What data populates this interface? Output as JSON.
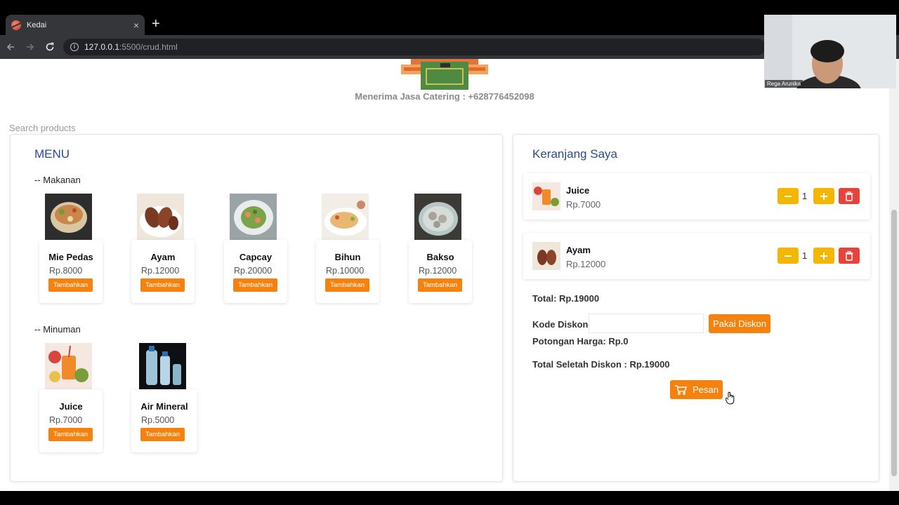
{
  "browser": {
    "tab_title": "Kedai",
    "tab_close": "×",
    "new_tab": "+",
    "url_host": "127.0.0.1",
    "url_path": ":5500/crud.html"
  },
  "header": {
    "catering_text": "Menerima Jasa Catering : +628776452098"
  },
  "search": {
    "placeholder": "Search products"
  },
  "menu": {
    "title": "MENU",
    "sections": [
      {
        "label": "-- Makanan",
        "items": [
          {
            "name": "Mie Pedas",
            "price": "Rp.8000",
            "button": "Tambahkan"
          },
          {
            "name": "Ayam",
            "price": "Rp.12000",
            "button": "Tambahkan"
          },
          {
            "name": "Capcay",
            "price": "Rp.20000",
            "button": "Tambahkan"
          },
          {
            "name": "Bihun",
            "price": "Rp.10000",
            "button": "Tambahkan"
          },
          {
            "name": "Bakso",
            "price": "Rp.12000",
            "button": "Tambahkan"
          }
        ]
      },
      {
        "label": "-- Minuman",
        "items": [
          {
            "name": "Juice",
            "price": "Rp.7000",
            "button": "Tambahkan"
          },
          {
            "name": "Air Mineral",
            "price": "Rp.5000",
            "button": "Tambahkan"
          }
        ]
      }
    ]
  },
  "cart": {
    "title": "Keranjang Saya",
    "items": [
      {
        "name": "Juice",
        "price": "Rp.7000",
        "qty": "1"
      },
      {
        "name": "Ayam",
        "price": "Rp.12000",
        "qty": "1"
      }
    ],
    "total": "Total: Rp.19000",
    "discount_label": "Kode Diskon:",
    "discount_value": "",
    "apply_button": "Pakai Diskon",
    "cut_price": "Potongan Harga: Rp.0",
    "after_discount": "Total Seletah Diskon : Rp.19000",
    "order_button": "Pesan"
  },
  "webcam": {
    "name": "Rega Arunika"
  },
  "colors": {
    "accent_orange": "#f5820e",
    "qty_yellow": "#f5b600",
    "delete_red": "#e5443d",
    "title_blue": "#2c4a8a"
  }
}
